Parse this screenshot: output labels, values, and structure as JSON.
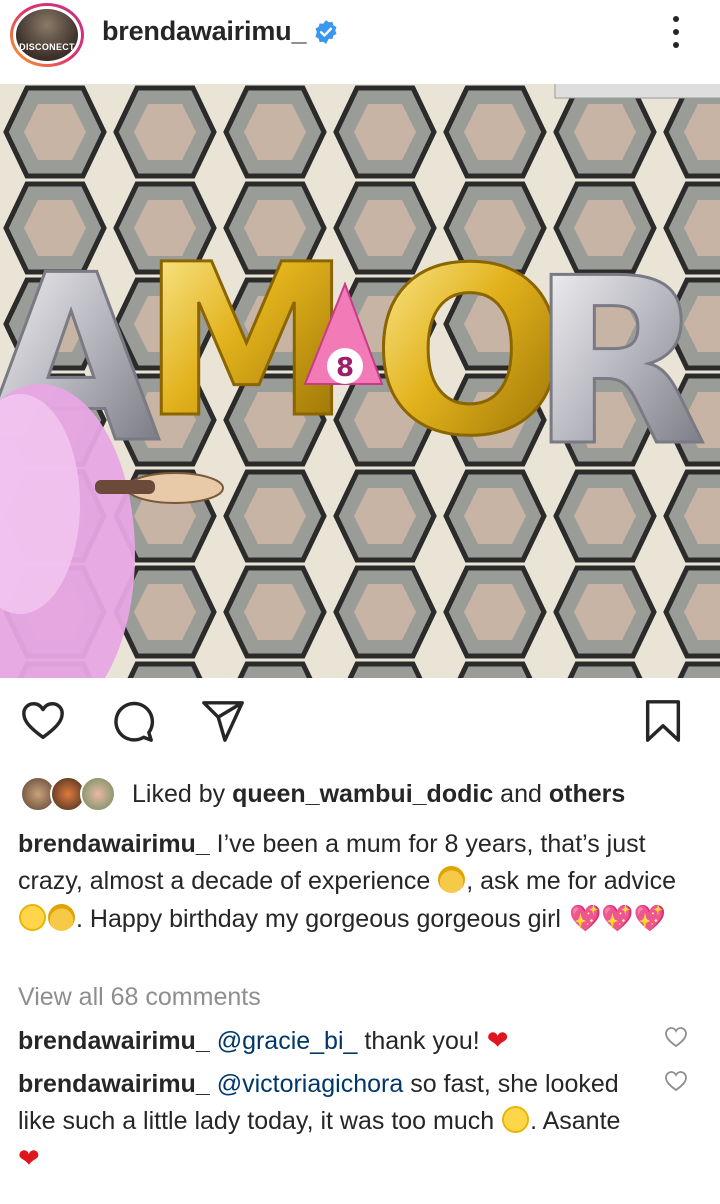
{
  "header": {
    "username": "brendawairimu_",
    "avatar_text": "DISCONECT",
    "verified_icon": "verified-badge-icon",
    "more_icon": "more-vertical-icon"
  },
  "photo": {
    "balloon_letters": [
      "A",
      "M",
      "O",
      "R"
    ],
    "hat_number": "8"
  },
  "actions": {
    "like_icon": "heart-icon",
    "comment_icon": "comment-icon",
    "share_icon": "send-icon",
    "save_icon": "bookmark-icon"
  },
  "likes": {
    "prefix": "Liked by ",
    "user": "queen_wambui_dodic",
    "middle": " and ",
    "others": "others"
  },
  "caption": {
    "username": "brendawairimu_",
    "part1": " I’ve been a mum for 8 years, that’s just crazy, almost a decade of experience ",
    "part2": ", ask me for advice ",
    "part3": ". Happy birthday my gorgeous gorgeous girl "
  },
  "view_all_comments": "View all 68 comments",
  "comments": [
    {
      "username": "brendawairimu_",
      "mention": "@gracie_bi_",
      "text": " thank you! ",
      "tail": ""
    },
    {
      "username": "brendawairimu_",
      "mention": "@victoriagichora",
      "text": " so fast, she looked like such a little lady today, it was too much ",
      "tail": ". Asante "
    }
  ],
  "colors": {
    "text": "#262626",
    "muted": "#8e8e8e",
    "mention": "#00376b",
    "verified": "#3897f0",
    "heart_red": "#e0161e"
  }
}
